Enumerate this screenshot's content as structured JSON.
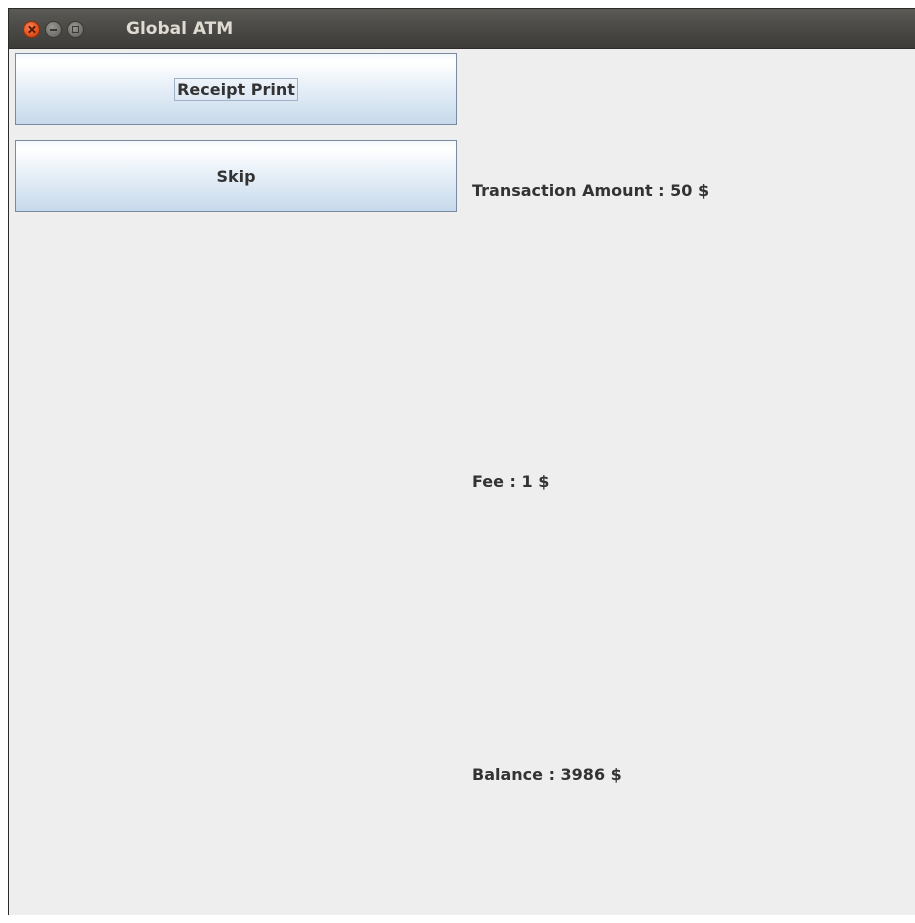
{
  "window": {
    "title": "Global ATM"
  },
  "buttons": {
    "receipt_print": "Receipt Print",
    "skip": "Skip"
  },
  "info": {
    "transaction_amount": "Transaction Amount : 50 $",
    "fee": "Fee : 1 $",
    "balance": "Balance : 3986 $"
  },
  "icons": {
    "close": "close-icon",
    "minimize": "minimize-icon",
    "maximize": "maximize-icon"
  },
  "colors": {
    "titlebar": "#4a4945",
    "close_button": "#e35520",
    "background": "#eeeeee",
    "button_gradient_bottom": "#c6d8ea",
    "text": "#333333"
  }
}
